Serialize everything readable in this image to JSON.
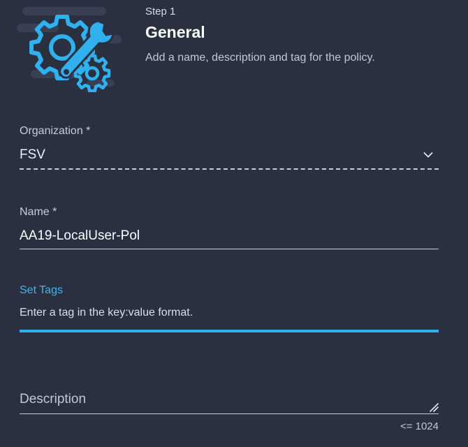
{
  "colors": {
    "background": "#2b3041",
    "accent": "#2fb0ef",
    "label": "#c9ccd6",
    "text": "#ffffff"
  },
  "header": {
    "illustration_icon": "gear-wrench-icon",
    "step_label": "Step 1",
    "title": "General",
    "description": "Add a name, description and tag for the policy."
  },
  "form": {
    "organization": {
      "label": "Organization *",
      "value": "FSV",
      "icon": "chevron-down-icon"
    },
    "name": {
      "label": "Name *",
      "value": "AA19-LocalUser-Pol"
    },
    "tags": {
      "label": "Set Tags",
      "placeholder": "Enter a tag in the key:value format."
    },
    "description": {
      "placeholder": "Description",
      "char_limit": "<= 1024",
      "icon": "resize-handle-icon"
    }
  }
}
